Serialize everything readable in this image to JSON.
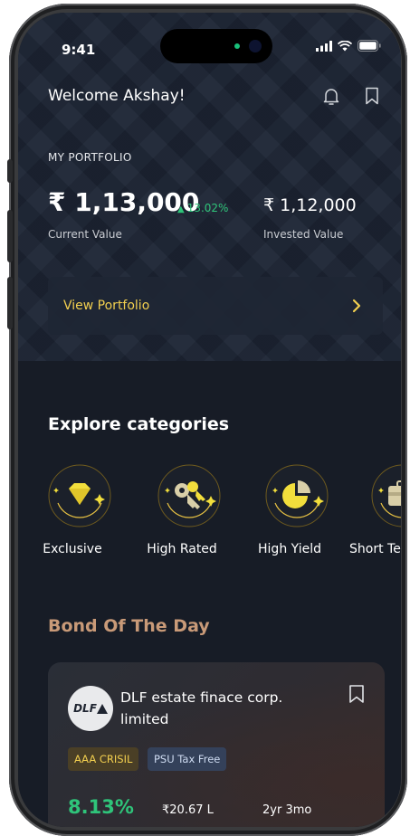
{
  "status_bar": {
    "time": "9:41"
  },
  "header": {
    "welcome": "Welcome Akshay!"
  },
  "portfolio": {
    "label": "MY PORTFOLIO",
    "current_value": "₹ 1,13,000",
    "change": "13.02%",
    "current_label": "Current Value",
    "invested_value": "₹ 1,12,000",
    "invested_label": "Invested Value",
    "view_button": "View Portfolio"
  },
  "explore": {
    "title": "Explore categories",
    "categories": [
      {
        "label": "Exclusive",
        "icon": "diamond-icon"
      },
      {
        "label": "High Rated",
        "icon": "keys-icon"
      },
      {
        "label": "High Yield",
        "icon": "pie-chart-icon"
      },
      {
        "label": "Short Ter",
        "icon": "briefcase-icon"
      }
    ]
  },
  "bond_of_day": {
    "title": "Bond Of The Day",
    "logo_text": "DLF",
    "name": "DLF estate finace corp. limited",
    "badges": [
      "AAA CRISIL",
      "PSU Tax Free"
    ],
    "yield": "8.13%",
    "amount": "₹20.67 L",
    "tenure": "2yr 3mo"
  },
  "colors": {
    "background": "#171c26",
    "accent_gold": "#f2cf4f",
    "positive_green": "#2fc47a",
    "bond_title": "#c99a78"
  }
}
